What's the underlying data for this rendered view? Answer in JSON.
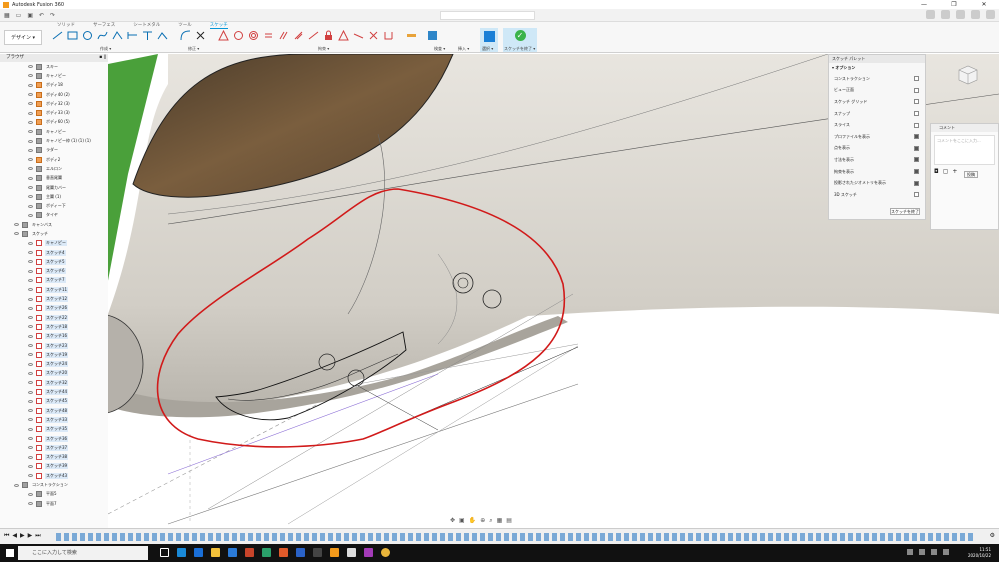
{
  "window": {
    "title": "Autodesk Fusion 360"
  },
  "ribbon": {
    "tabs": [
      "ソリッド",
      "サーフェス",
      "シートメタル",
      "ツール",
      "スケッチ"
    ],
    "design_label": "デザイン ▾",
    "groups": [
      "作成 ▾",
      "修正 ▾",
      "拘束 ▾",
      "検査 ▾",
      "挿入 ▾",
      "選択 ▾",
      "スケッチを終了 ▾"
    ]
  },
  "browser": {
    "title": "ブラウザ",
    "items": [
      {
        "label": "スキー",
        "type": "folder"
      },
      {
        "label": "キャノピー",
        "type": "folder"
      },
      {
        "label": "ボディ18",
        "type": "body"
      },
      {
        "label": "ボディ40 (2)",
        "type": "body"
      },
      {
        "label": "ボディ32 (3)",
        "type": "body"
      },
      {
        "label": "ボディ33 (3)",
        "type": "body"
      },
      {
        "label": "ボディ60 (5)",
        "type": "body"
      },
      {
        "label": "キャノピー",
        "type": "folder"
      },
      {
        "label": "キャノピー枠 (1) (1) (1)",
        "type": "folder"
      },
      {
        "label": "ラダー",
        "type": "folder"
      },
      {
        "label": "ボディ2",
        "type": "body"
      },
      {
        "label": "エルロン",
        "type": "folder"
      },
      {
        "label": "垂直尾翼",
        "type": "folder"
      },
      {
        "label": "尾翼カバー",
        "type": "folder"
      },
      {
        "label": "主翼 (1)",
        "type": "folder"
      },
      {
        "label": "ボディー下",
        "type": "folder"
      },
      {
        "label": "タイヤ",
        "type": "folder"
      },
      {
        "label": "キャンバス",
        "type": "folder"
      },
      {
        "label": "スケッチ",
        "type": "folder"
      },
      {
        "label": "キャノピー",
        "type": "sketch"
      },
      {
        "label": "スケッチ4",
        "type": "sketch"
      },
      {
        "label": "スケッチ5",
        "type": "sketch"
      },
      {
        "label": "スケッチ6",
        "type": "sketch"
      },
      {
        "label": "スケッチ7",
        "type": "sketch"
      },
      {
        "label": "スケッチ11",
        "type": "sketch"
      },
      {
        "label": "スケッチ12",
        "type": "sketch"
      },
      {
        "label": "スケッチ26",
        "type": "sketch"
      },
      {
        "label": "スケッチ22",
        "type": "sketch"
      },
      {
        "label": "スケッチ18",
        "type": "sketch"
      },
      {
        "label": "スケッチ16",
        "type": "sketch"
      },
      {
        "label": "スケッチ23",
        "type": "sketch"
      },
      {
        "label": "スケッチ19",
        "type": "sketch"
      },
      {
        "label": "スケッチ24",
        "type": "sketch"
      },
      {
        "label": "スケッチ20",
        "type": "sketch"
      },
      {
        "label": "スケッチ32",
        "type": "sketch"
      },
      {
        "label": "スケッチ44",
        "type": "sketch"
      },
      {
        "label": "スケッチ45",
        "type": "sketch"
      },
      {
        "label": "スケッチ48",
        "type": "sketch"
      },
      {
        "label": "スケッチ33",
        "type": "sketch"
      },
      {
        "label": "スケッチ35",
        "type": "sketch"
      },
      {
        "label": "スケッチ36",
        "type": "sketch"
      },
      {
        "label": "スケッチ37",
        "type": "sketch"
      },
      {
        "label": "スケッチ38",
        "type": "sketch"
      },
      {
        "label": "スケッチ39",
        "type": "sketch"
      },
      {
        "label": "スケッチ43",
        "type": "sketch"
      },
      {
        "label": "コンストラクション",
        "type": "folder"
      },
      {
        "label": "平面5",
        "type": "folder"
      },
      {
        "label": "平面7",
        "type": "folder"
      }
    ]
  },
  "palette": {
    "title": "スケッチ パレット",
    "section": "▾ オプション",
    "options": [
      {
        "label": "コンストラクション",
        "on": false
      },
      {
        "label": "ビュー正面",
        "on": false
      },
      {
        "label": "スケッチ グリッド",
        "on": false
      },
      {
        "label": "スナップ",
        "on": false
      },
      {
        "label": "スライス",
        "on": false
      },
      {
        "label": "プロファイルを表示",
        "on": true
      },
      {
        "label": "点を表示",
        "on": true
      },
      {
        "label": "寸法を表示",
        "on": true
      },
      {
        "label": "拘束を表示",
        "on": true
      },
      {
        "label": "投影されたジオメトリを表示",
        "on": true
      },
      {
        "label": "3D スケッチ",
        "on": false
      }
    ],
    "finish_label": "スケッチを終了"
  },
  "comment": {
    "title": "コメント",
    "placeholder": "コメントをここに入力...",
    "post_label": "投稿"
  },
  "taskbar": {
    "search_placeholder": "ここに入力して検索",
    "time": "11:51",
    "date": "2020/10/22"
  },
  "colors": {
    "accent": "#0696d7",
    "finish": "#3bb34a",
    "annotation": "#d11a1a",
    "model": "#d9d6cf",
    "green_body": "#4aa03a"
  }
}
